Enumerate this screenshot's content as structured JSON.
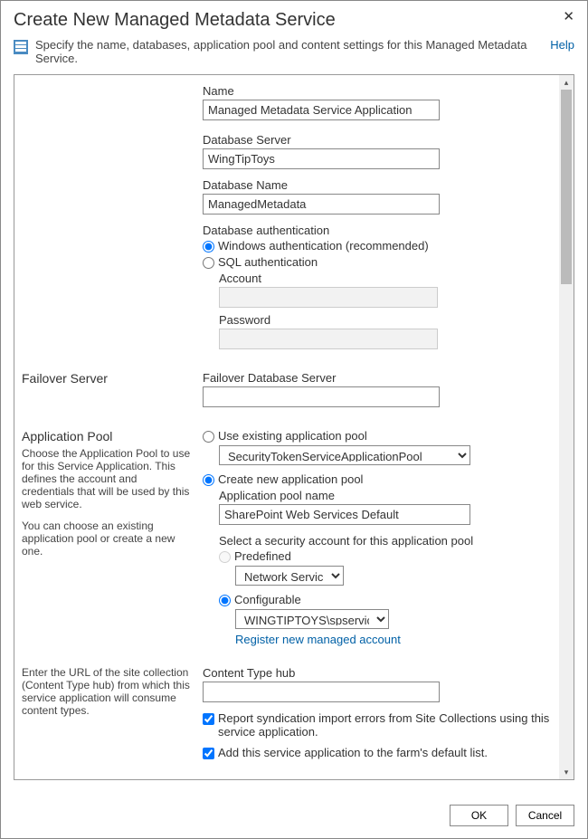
{
  "dialog": {
    "title": "Create New Managed Metadata Service",
    "description": "Specify the name, databases, application pool and content settings for this Managed Metadata Service.",
    "help": "Help"
  },
  "name": {
    "label": "Name",
    "value": "Managed Metadata Service Application"
  },
  "db": {
    "server_label": "Database Server",
    "server_value": "WingTipToys",
    "name_label": "Database Name",
    "name_value": "ManagedMetadata",
    "auth_label": "Database authentication",
    "auth_windows": "Windows authentication (recommended)",
    "auth_sql": "SQL authentication",
    "account_label": "Account",
    "password_label": "Password"
  },
  "failover": {
    "left": "Failover Server",
    "label": "Failover Database Server"
  },
  "apppool": {
    "left_title": "Application Pool",
    "left_desc1": "Choose the Application Pool to use for this Service Application.  This defines the account and credentials that will be used by this web service.",
    "left_desc2": "You can choose an existing application pool or create a new one.",
    "use_existing": "Use existing application pool",
    "existing_value": "SecurityTokenServiceApplicationPool",
    "create_new": "Create new application pool",
    "pool_name_label": "Application pool name",
    "pool_name_value": "SharePoint Web Services Default",
    "select_account_label": "Select a security account for this application pool",
    "predefined": "Predefined",
    "predefined_value": "Network Service",
    "configurable": "Configurable",
    "configurable_value": "WINGTIPTOYS\\spservices",
    "register_link": "Register new managed account"
  },
  "cth": {
    "left_desc": "Enter the URL of the site collection (Content Type hub) from which this service application will consume content types.",
    "label": "Content Type hub",
    "check1": "Report syndication import errors from Site Collections using this service application.",
    "check2": "Add this service application to the farm's default list."
  },
  "buttons": {
    "ok": "OK",
    "cancel": "Cancel"
  }
}
